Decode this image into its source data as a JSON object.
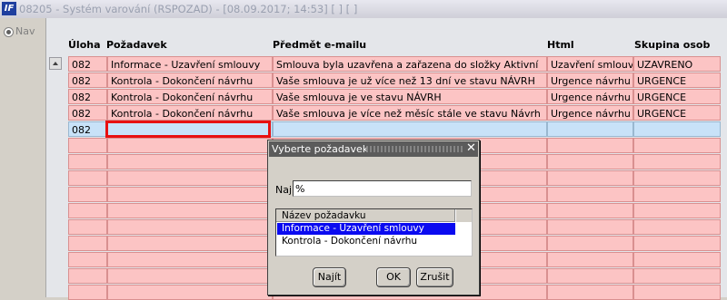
{
  "window": {
    "app_icon_text": "IF",
    "title": "08205 - Systém varování (RSPOZAD) - [08.09.2017; 14:53]  [ ]  [ ]"
  },
  "left_panel": {
    "nav_label": "Nav"
  },
  "grid": {
    "headers": {
      "uloha": "Úloha",
      "pozadavek": "Požadavek",
      "predmet": "Předmět e-mailu",
      "html": "Html",
      "skupina": "Skupina osob"
    },
    "rows": [
      {
        "uloha": "082",
        "pozadavek": "Informace - Uzavření smlouvy",
        "predmet": "Smlouva byla uzavřena a zařazena do složky Aktivní",
        "html": "Uzavření smlouvy",
        "skupina": "UZAVRENO"
      },
      {
        "uloha": "082",
        "pozadavek": "Kontrola - Dokončení návrhu",
        "predmet": "Vaše smlouva je už více než 13 dní ve stavu NÁVRH",
        "html": "Urgence návrhu",
        "skupina": "URGENCE"
      },
      {
        "uloha": "082",
        "pozadavek": "Kontrola - Dokončení návrhu",
        "predmet": "Vaše smlouva je ve stavu NÁVRH",
        "html": "Urgence návrhu",
        "skupina": "URGENCE"
      },
      {
        "uloha": "082",
        "pozadavek": "Kontrola - Dokončení návrhu",
        "predmet": "Vaše smlouva je více než měsíc stále ve stavu Návrh",
        "html": "Urgence návrhu",
        "skupina": "URGENCE"
      },
      {
        "uloha": "082",
        "pozadavek": "",
        "predmet": "",
        "html": "",
        "skupina": ""
      },
      {
        "uloha": "",
        "pozadavek": "",
        "predmet": "",
        "html": "",
        "skupina": ""
      },
      {
        "uloha": "",
        "pozadavek": "",
        "predmet": "",
        "html": "",
        "skupina": ""
      },
      {
        "uloha": "",
        "pozadavek": "",
        "predmet": "",
        "html": "",
        "skupina": ""
      },
      {
        "uloha": "",
        "pozadavek": "",
        "predmet": "",
        "html": "",
        "skupina": ""
      },
      {
        "uloha": "",
        "pozadavek": "",
        "predmet": "",
        "html": "",
        "skupina": ""
      },
      {
        "uloha": "",
        "pozadavek": "",
        "predmet": "",
        "html": "",
        "skupina": ""
      },
      {
        "uloha": "",
        "pozadavek": "",
        "predmet": "",
        "html": "",
        "skupina": ""
      },
      {
        "uloha": "",
        "pozadavek": "",
        "predmet": "",
        "html": "",
        "skupina": ""
      },
      {
        "uloha": "",
        "pozadavek": "",
        "predmet": "",
        "html": "",
        "skupina": ""
      },
      {
        "uloha": "",
        "pozadavek": "",
        "predmet": "",
        "html": "",
        "skupina": ""
      }
    ],
    "current_row_color": "#c8e2f8",
    "row_color": "#fcc4c4",
    "focus_color": "#e81010"
  },
  "dialog": {
    "title": "Vyberte požadavek",
    "close_glyph": "✕",
    "search_label": "Najít",
    "search_value": "%",
    "list_header": "Název požadavku",
    "list_items": [
      {
        "label": "Informace - Uzavření smlouvy",
        "selected": true
      },
      {
        "label": "Kontrola - Dokončení návrhu",
        "selected": false
      }
    ],
    "buttons": {
      "find": "Najít",
      "ok": "OK",
      "cancel": "Zrušit"
    }
  }
}
